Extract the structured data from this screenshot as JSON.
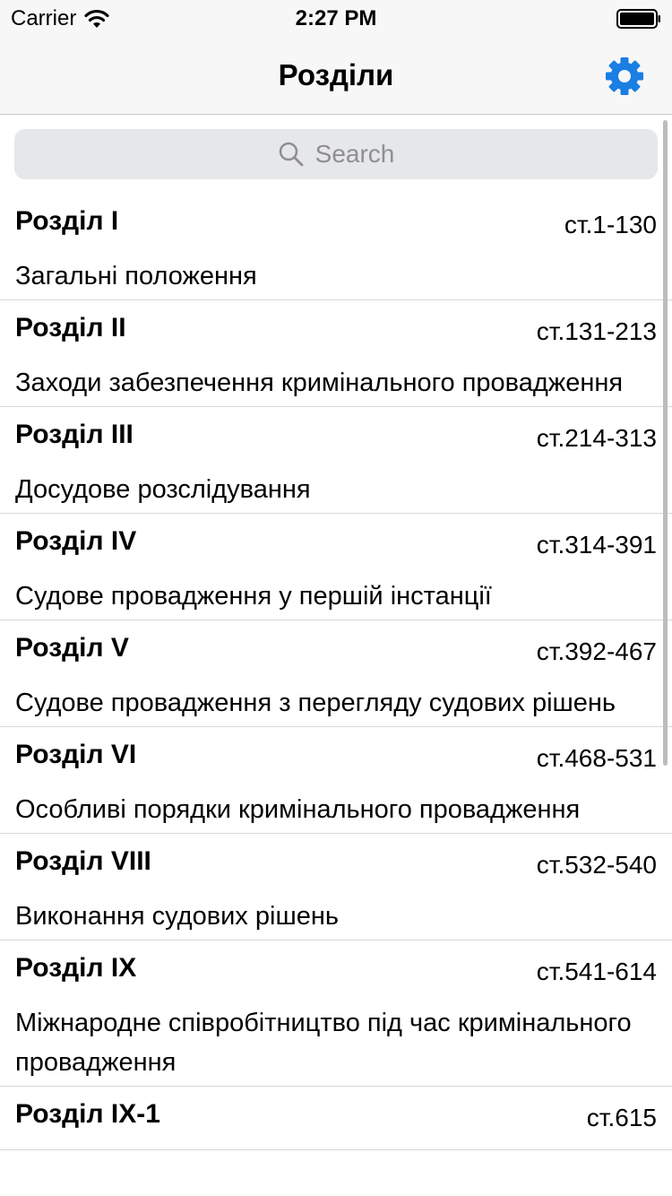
{
  "status_bar": {
    "carrier": "Carrier",
    "time": "2:27 PM"
  },
  "nav": {
    "title": "Розділи",
    "settings_icon": "gear-icon",
    "accent": "#1a7ee3"
  },
  "search": {
    "placeholder": "Search"
  },
  "sections": [
    {
      "title": "Розділ I",
      "range": "ст.1-130",
      "desc": "Загальні положення"
    },
    {
      "title": "Розділ II",
      "range": "ст.131-213",
      "desc": "Заходи забезпечення кримінального провадження"
    },
    {
      "title": "Розділ III",
      "range": "ст.214-313",
      "desc": "Досудове розслідування"
    },
    {
      "title": "Розділ IV",
      "range": "ст.314-391",
      "desc": "Судове провадження у першій інстанції"
    },
    {
      "title": "Розділ V",
      "range": "ст.392-467",
      "desc": "Судове провадження з перегляду судових рішень"
    },
    {
      "title": "Розділ VI",
      "range": "ст.468-531",
      "desc": "Особливі порядки кримінального провадження"
    },
    {
      "title": "Розділ VIII",
      "range": "ст.532-540",
      "desc": "Виконання судових рішень"
    },
    {
      "title": "Розділ IX",
      "range": "ст.541-614",
      "desc": "Міжнародне співробітництво під час кримінального провадження"
    },
    {
      "title": "Розділ IX-1",
      "range": "ст.615",
      "desc": ""
    }
  ]
}
